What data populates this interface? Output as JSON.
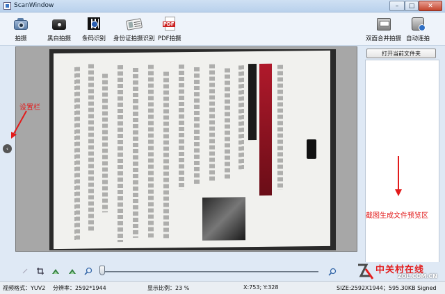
{
  "window": {
    "title": "ScanWindow",
    "controls": {
      "minimize": "–",
      "maximize": "□",
      "close": "✕"
    }
  },
  "toolbar": {
    "items": [
      {
        "label": "拍摄",
        "icon": "camera-icon"
      },
      {
        "label": "黑白拍摄",
        "icon": "bw-camera-icon"
      },
      {
        "label": "条码识别",
        "icon": "barcode-icon"
      },
      {
        "label": "身份证拍摄识别",
        "icon": "id-card-icon"
      },
      {
        "label": "PDF拍摄",
        "icon": "pdf-icon"
      },
      {
        "label": "双面合并拍摄",
        "icon": "duplex-scan-icon"
      },
      {
        "label": "自动连拍",
        "icon": "auto-shoot-icon"
      }
    ],
    "open_folder": "打开当前文件夹"
  },
  "annotations": {
    "settings_bar": "设置栏",
    "preview_area": "截图生成文件预览区"
  },
  "sidebar_toggle": "‹",
  "status": {
    "video_format": "视频格式：YUV2",
    "resolution": "分辨率：2592*1944",
    "scale": "显示比例：23 %",
    "coords": "X:753; Y:328",
    "size": "SIZE:2592X1944；595.30KB  Signed"
  },
  "watermark": {
    "cn": "中关村在线",
    "en": "ZOL.COM.CN"
  },
  "colors": {
    "accent_red": "#e21b1b",
    "titlebar": "#cfe0f3"
  },
  "zoom": {
    "level_percent": 23
  }
}
